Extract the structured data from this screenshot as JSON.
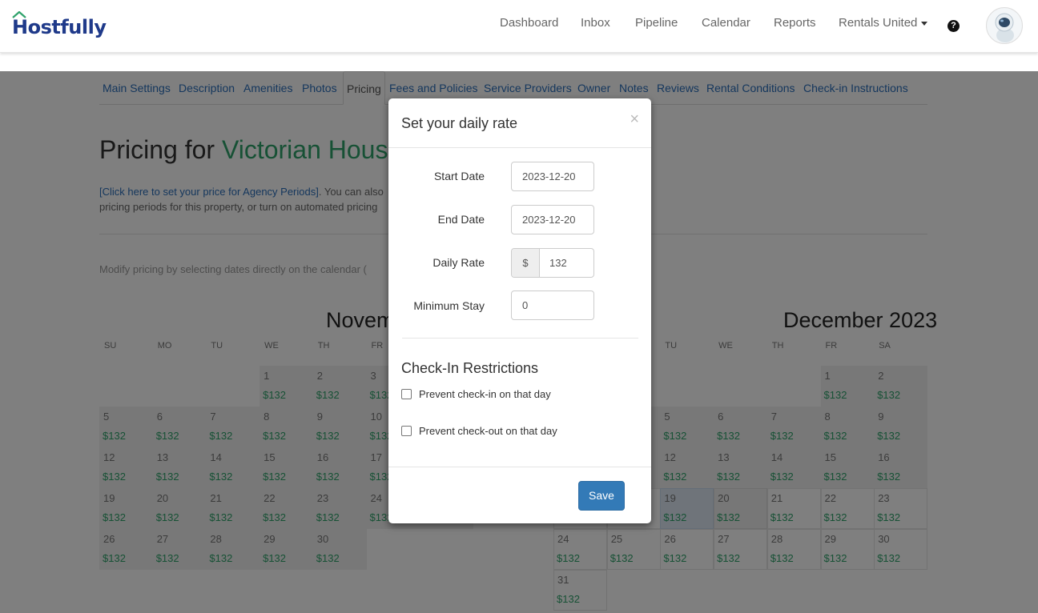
{
  "navbar": {
    "logo_text": "Hostfully",
    "links": [
      "Dashboard",
      "Inbox",
      "Pipeline",
      "Calendar",
      "Reports",
      "Rentals United"
    ],
    "help_icon": "question-circle-icon",
    "avatar_icon": "astronaut-avatar"
  },
  "tabs": [
    "Main Settings",
    "Description",
    "Amenities",
    "Photos",
    "Pricing",
    "Fees and Policies",
    "Service Providers",
    "Owner",
    "Notes",
    "Reviews",
    "Rental Conditions",
    "Check-in Instructions"
  ],
  "page": {
    "title_prefix": "Pricing for ",
    "property_name": "Victorian House",
    "intro_link": "[Click here to set your price for Agency Periods]",
    "intro_text": ". You can also",
    "intro_line2": "pricing periods for this property, or turn on automated pricing",
    "modify_text": "Modify pricing by selecting dates directly on the calendar (",
    "november_title": "November 2023",
    "december_title": "December 2023"
  },
  "calendar": {
    "dow_labels": [
      "SU",
      "MO",
      "TU",
      "WE",
      "TH",
      "FR",
      "SA"
    ],
    "price": "$132"
  },
  "modal": {
    "title": "Set your daily rate",
    "close": "×",
    "start_label": "Start Date",
    "start_value": "2023-12-20",
    "end_label": "End Date",
    "end_value": "2023-12-20",
    "rate_label": "Daily Rate",
    "currency": "$",
    "rate_value": "132",
    "min_stay_label": "Minimum Stay",
    "min_stay_value": "0",
    "restrictions_title": "Check-In Restrictions",
    "check_in_label": "Prevent check-in on that day",
    "check_out_label": "Prevent check-out on that day",
    "save_label": "Save"
  }
}
